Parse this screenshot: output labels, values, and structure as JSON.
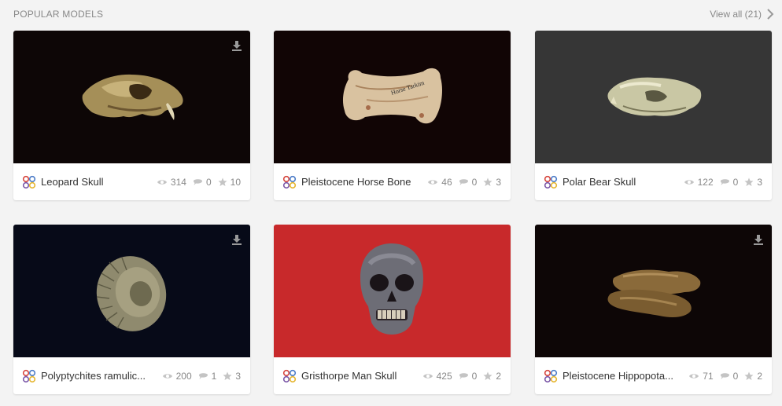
{
  "section": {
    "title": "POPULAR MODELS",
    "view_all": "View all (21)"
  },
  "models": [
    {
      "name": "Leopard Skull",
      "views": "314",
      "comments": "0",
      "likes": "10",
      "bg": "#0d0606"
    },
    {
      "name": "Pleistocene Horse Bone",
      "views": "46",
      "comments": "0",
      "likes": "3",
      "bg": "#110505"
    },
    {
      "name": "Polar Bear Skull",
      "views": "122",
      "comments": "0",
      "likes": "3",
      "bg": "#363636"
    },
    {
      "name": "Polyptychites ramulic...",
      "views": "200",
      "comments": "1",
      "likes": "3",
      "bg": "#070a18"
    },
    {
      "name": "Gristhorpe Man Skull",
      "views": "425",
      "comments": "0",
      "likes": "2",
      "bg": "#c8292b"
    },
    {
      "name": "Pleistocene Hippopota...",
      "views": "71",
      "comments": "0",
      "likes": "2",
      "bg": "#0d0606"
    }
  ],
  "bone_label": "Horse Tarkim"
}
